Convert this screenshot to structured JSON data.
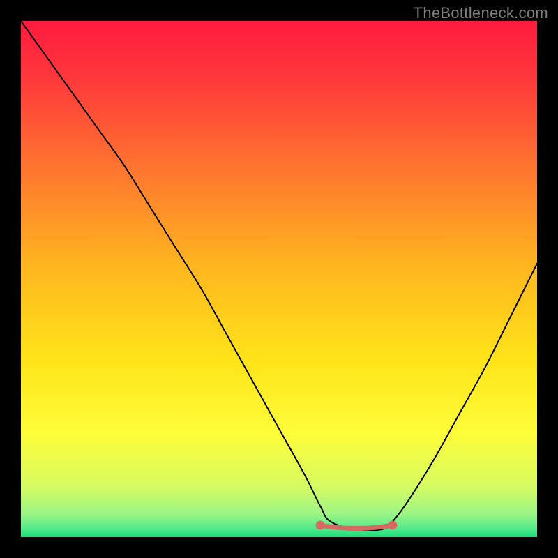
{
  "watermark": "TheBottleneck.com",
  "chart_data": {
    "type": "line",
    "title": "",
    "xlabel": "",
    "ylabel": "",
    "xlim": [
      0,
      100
    ],
    "ylim": [
      0,
      100
    ],
    "background_gradient_stops": [
      {
        "offset": 0.0,
        "color": "#ff1a3f"
      },
      {
        "offset": 0.12,
        "color": "#ff3b3b"
      },
      {
        "offset": 0.3,
        "color": "#ff7a2e"
      },
      {
        "offset": 0.48,
        "color": "#ffb71f"
      },
      {
        "offset": 0.66,
        "color": "#ffe419"
      },
      {
        "offset": 0.8,
        "color": "#fdfd3a"
      },
      {
        "offset": 0.9,
        "color": "#d7fb60"
      },
      {
        "offset": 0.955,
        "color": "#9cf585"
      },
      {
        "offset": 0.985,
        "color": "#4ee98c"
      },
      {
        "offset": 1.0,
        "color": "#19db7a"
      }
    ],
    "series": [
      {
        "name": "bottleneck-curve",
        "color": "#000000",
        "x": [
          0,
          5,
          10,
          15,
          20,
          25,
          30,
          35,
          40,
          45,
          50,
          55,
          58,
          60,
          65,
          70,
          72,
          75,
          80,
          85,
          90,
          95,
          100
        ],
        "y": [
          100,
          93,
          86,
          79,
          72,
          64,
          56,
          48,
          39,
          30,
          21,
          12,
          6,
          3,
          1.5,
          1.5,
          3,
          7,
          15,
          24,
          33,
          43,
          53
        ]
      },
      {
        "name": "sweet-spot-segment",
        "color": "#d66a62",
        "x": [
          58,
          60,
          62,
          64,
          66,
          68,
          70,
          72
        ],
        "y": [
          2.3,
          2.0,
          1.8,
          1.7,
          1.7,
          1.8,
          2.0,
          2.3
        ]
      }
    ],
    "sweet_spot_markers": {
      "color": "#d66a62",
      "points": [
        {
          "x": 58,
          "y": 2.3
        },
        {
          "x": 72,
          "y": 2.3
        }
      ]
    }
  }
}
